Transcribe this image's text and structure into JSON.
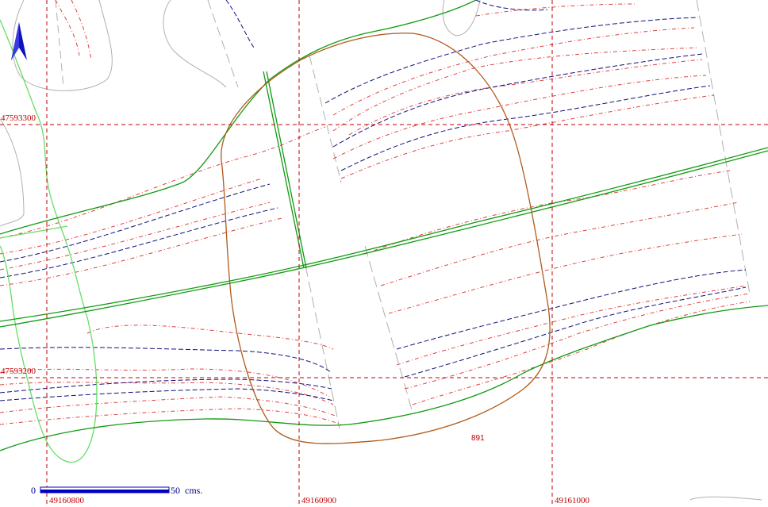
{
  "map": {
    "background_color": "#ffffff",
    "grid": {
      "line_color": "#c00000",
      "style": "dashed",
      "x_labels": [
        "49160800",
        "49160900",
        "49161000"
      ],
      "y_labels": [
        "47593300",
        "47593200"
      ]
    },
    "north_arrow": {
      "icon": "north-arrow-icon",
      "color": "#1010c0"
    },
    "feature_label": "891",
    "scale_bar": {
      "start_label": "0",
      "end_label": "50",
      "unit": "cms.",
      "color": "#0000c0"
    },
    "colors": {
      "contour_red": "#e04040",
      "contour_blue": "#10107a",
      "road_green": "#119a11",
      "light_green": "#66dd66",
      "boundary_brown": "#b05a1a",
      "gray_lines": "#b0b0b0"
    }
  }
}
